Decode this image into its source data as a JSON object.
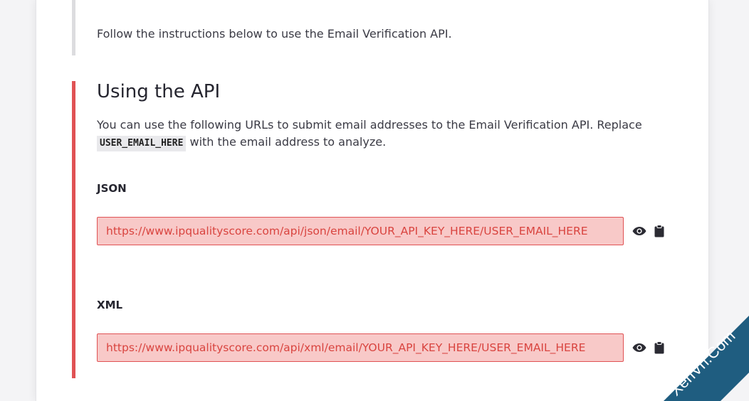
{
  "intro": {
    "text": "Follow the instructions below to use the Email Verification API."
  },
  "section": {
    "title": "Using the API",
    "desc_before": "You can use the following URLs to submit email addresses to the Email Verification API. Replace ",
    "code": "USER_EMAIL_HERE",
    "desc_after": " with the email address to analyze."
  },
  "endpoints": [
    {
      "label": "JSON",
      "url": "https://www.ipqualityscore.com/api/json/email/YOUR_API_KEY_HERE/USER_EMAIL_HERE"
    },
    {
      "label": "XML",
      "url": "https://www.ipqualityscore.com/api/xml/email/YOUR_API_KEY_HERE/USER_EMAIL_HERE"
    }
  ],
  "icons": {
    "reveal": "eye-icon",
    "copy": "clipboard-icon"
  },
  "watermark": {
    "text": "XenVn.Com"
  },
  "colors": {
    "accent": "#e05254",
    "url_bg": "#f8c9c8",
    "url_text": "#d9443f",
    "watermark_bg": "#1f5d80"
  }
}
